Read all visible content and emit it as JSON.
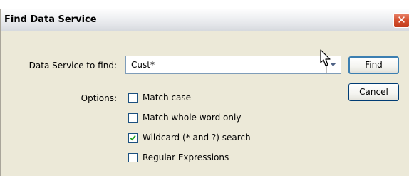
{
  "window": {
    "title": "Find Data Service",
    "close_icon": "close-x-icon"
  },
  "form": {
    "find_label": "Data Service to find:",
    "find_value": "Cust*",
    "options_label": "Options:"
  },
  "buttons": {
    "find": "Find",
    "cancel": "Cancel"
  },
  "options": [
    {
      "label": "Match case",
      "checked": false
    },
    {
      "label": "Match whole word only",
      "checked": false
    },
    {
      "label": "Wildcard (* and ?) search",
      "checked": true
    },
    {
      "label": "Regular Expressions",
      "checked": false
    }
  ],
  "colors": {
    "dialog_bg": "#ece9d8",
    "close_button": "#d4502f",
    "input_border": "#7f9db9",
    "checkbox_border": "#1c5180"
  }
}
